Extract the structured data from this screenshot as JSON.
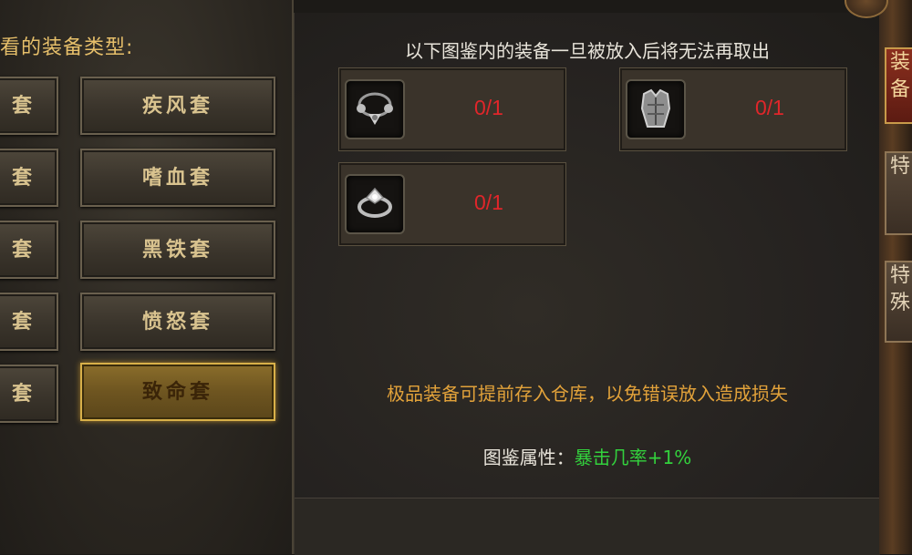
{
  "left": {
    "header": "看的装备类型:",
    "stub_label": "套",
    "sets": [
      {
        "label": "疾风套",
        "active": false
      },
      {
        "label": "嗜血套",
        "active": false
      },
      {
        "label": "黑铁套",
        "active": false
      },
      {
        "label": "愤怒套",
        "active": false
      },
      {
        "label": "致命套",
        "active": true
      }
    ]
  },
  "right": {
    "notice": "以下图鉴内的装备一旦被放入后将无法再取出",
    "slots": [
      {
        "icon": "necklace-icon",
        "count": "0/1"
      },
      {
        "icon": "armor-icon",
        "count": "0/1"
      },
      {
        "icon": "ring-icon",
        "count": "0/1"
      }
    ],
    "tip": "极品装备可提前存入仓库，以免错误放入造成损失",
    "attribute_label": "图鉴属性：",
    "attribute_value": "暴击几率+1%"
  },
  "side_tabs": [
    {
      "text": "装备"
    },
    {
      "text": "特"
    },
    {
      "text": "特殊"
    }
  ],
  "colors": {
    "accent_gold": "#e6bf6a",
    "count_red": "#e0262a",
    "tip_orange": "#e2a23a",
    "attribute_green": "#33d13d"
  }
}
